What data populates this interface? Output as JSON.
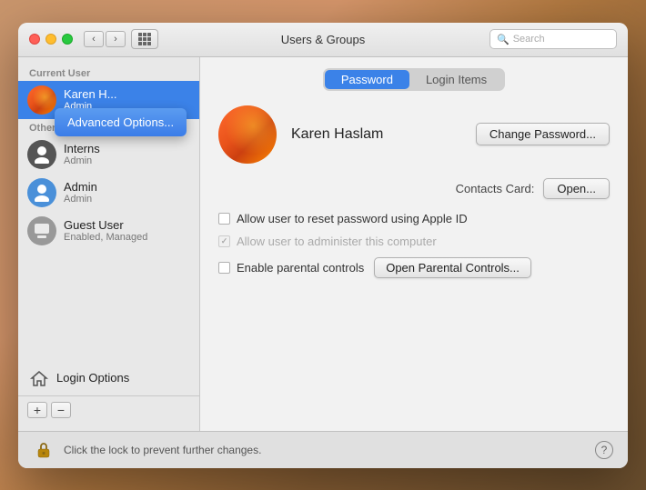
{
  "window": {
    "title": "Users & Groups",
    "search_placeholder": "Search"
  },
  "traffic_lights": {
    "close": "close",
    "minimize": "minimize",
    "maximize": "maximize"
  },
  "tabs": {
    "password": "Password",
    "login_items": "Login Items",
    "active": "password"
  },
  "sidebar": {
    "current_user_label": "Current User",
    "other_users_label": "Other Users",
    "users": [
      {
        "name": "Karen H...",
        "role": "Admin",
        "type": "current",
        "avatar": "karen"
      },
      {
        "name": "Interns",
        "role": "Admin",
        "type": "other",
        "avatar": "interns"
      },
      {
        "name": "Admin",
        "role": "Admin",
        "type": "other",
        "avatar": "admin"
      },
      {
        "name": "Guest User",
        "role": "Enabled, Managed",
        "type": "other",
        "avatar": "guest"
      }
    ],
    "login_options_label": "Login Options",
    "add_button": "+",
    "remove_button": "−"
  },
  "main": {
    "user_name": "Karen Haslam",
    "change_password_label": "Change Password...",
    "contacts_label": "Contacts Card:",
    "open_label": "Open...",
    "checkboxes": {
      "reset_password": "Allow user to reset password using Apple ID",
      "administer": "Allow user to administer this computer",
      "parental_controls": "Enable parental controls"
    },
    "parental_btn_label": "Open Parental Controls..."
  },
  "context_menu": {
    "label": "Advanced Options..."
  },
  "bottom_bar": {
    "lock_text": "Click the lock to prevent further changes.",
    "help_label": "?"
  }
}
